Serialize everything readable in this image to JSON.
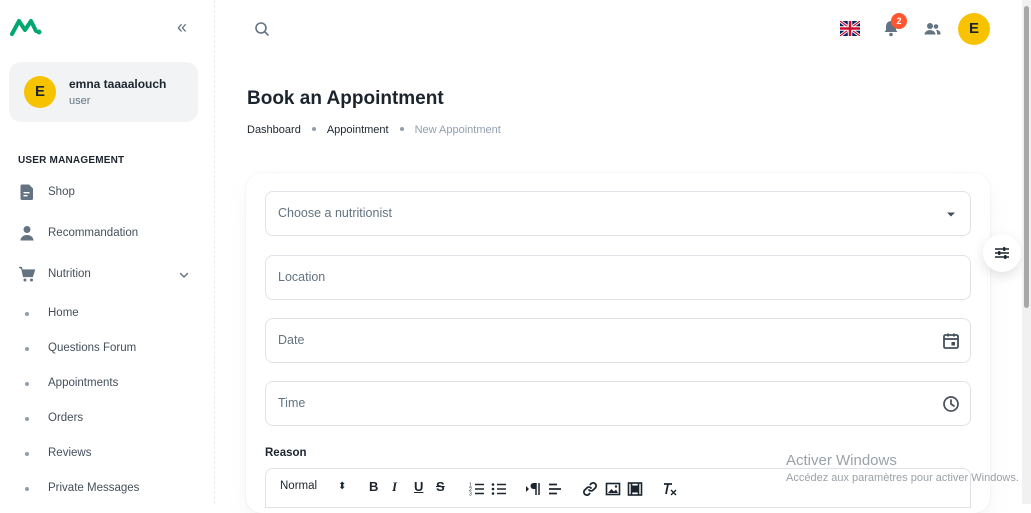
{
  "sidebar": {
    "user": {
      "initial": "E",
      "name": "emna taaaalouch",
      "role": "user"
    },
    "section_title": "USER MANAGEMENT",
    "items": [
      {
        "label": "Shop",
        "icon": "file-icon"
      },
      {
        "label": "Recommandation",
        "icon": "person-icon"
      },
      {
        "label": "Nutrition",
        "icon": "cart-icon",
        "expanded": true
      }
    ],
    "sub_items": [
      {
        "label": "Home"
      },
      {
        "label": "Questions Forum"
      },
      {
        "label": "Appointments"
      },
      {
        "label": "Orders"
      },
      {
        "label": "Reviews"
      },
      {
        "label": "Private Messages"
      }
    ]
  },
  "header": {
    "notifications_count": "2",
    "avatar_initial": "E",
    "language": "English (UK flag)"
  },
  "page": {
    "title": "Book an Appointment",
    "breadcrumb": [
      "Dashboard",
      "Appointment",
      "New Appointment"
    ]
  },
  "form": {
    "nutritionist_placeholder": "Choose a nutritionist",
    "location_placeholder": "Location",
    "date_placeholder": "Date",
    "time_placeholder": "Time",
    "reason_label": "Reason",
    "editor_format": "Normal",
    "editor_buttons": {
      "bold": "B",
      "italic": "I",
      "underline": "U",
      "strike": "S"
    }
  },
  "watermark": {
    "title": "Activer Windows",
    "subtitle": "Accédez aux paramètres pour activer Windows."
  },
  "colors": {
    "accent_green": "#00a76f",
    "avatar_yellow": "#f7c300",
    "badge_red": "#ff5630"
  }
}
